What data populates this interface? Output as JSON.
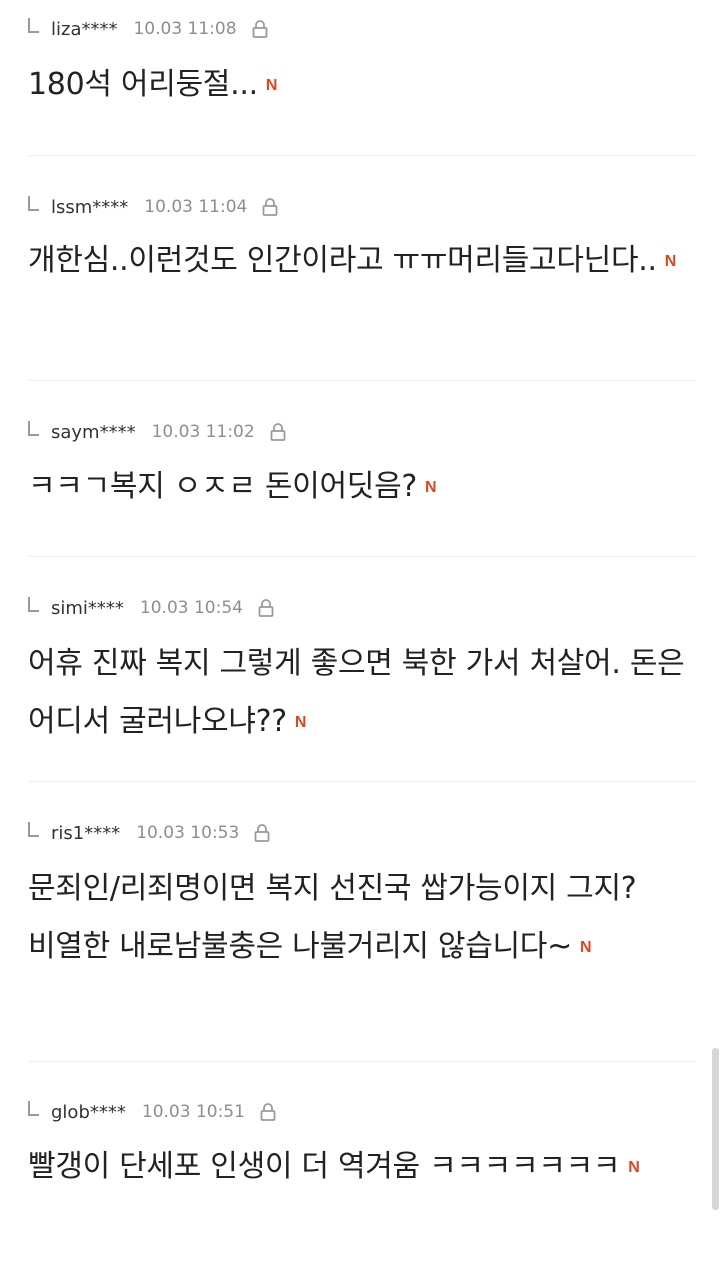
{
  "comments": [
    {
      "author": "liza****",
      "time": "10.03 11:08",
      "text": "180석 어리둥절...",
      "new_badge": "N"
    },
    {
      "author": "lssm****",
      "time": "10.03 11:04",
      "text": "개한심..이런것도 인간이라고 ㅠㅠ머리들고다닌다..",
      "new_badge": "N"
    },
    {
      "author": "saym****",
      "time": "10.03 11:02",
      "text": "ㅋㅋㄱ복지 ㅇㅈㄹ 돈이어딧음?",
      "new_badge": "N"
    },
    {
      "author": "simi****",
      "time": "10.03 10:54",
      "text": "어휴 진짜 복지 그렇게 좋으면 북한 가서 처살어. 돈은 어디서 굴러나오냐??",
      "new_badge": "N"
    },
    {
      "author": "ris1****",
      "time": "10.03 10:53",
      "text": "문죄인/리죄명이면 복지 선진국 쌉가능이지 그지? 비열한 내로남불충은 나불거리지 않습니다~",
      "new_badge": "N"
    },
    {
      "author": "glob****",
      "time": "10.03 10:51",
      "text": "빨갱이 단세포 인생이 더 역겨움 ㅋㅋㅋㅋㅋㅋㅋ",
      "new_badge": "N"
    }
  ],
  "icons": {
    "reply": "reply-arrow-icon",
    "lock": "lock-icon",
    "new": "new-badge-icon"
  },
  "colors": {
    "new_badge": "#e0461a",
    "author": "#333333",
    "time": "#8e8e8e",
    "body": "#222222",
    "divider": "#eeeeee"
  }
}
